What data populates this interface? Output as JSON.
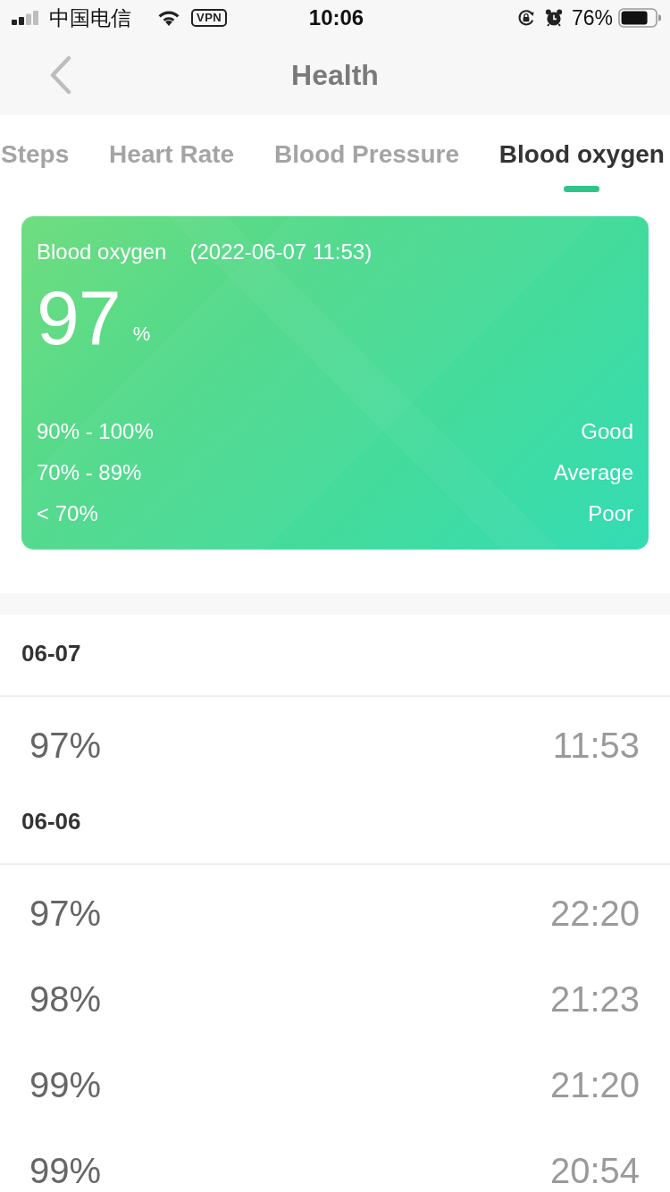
{
  "status_bar": {
    "carrier": "中国电信",
    "vpn": "VPN",
    "time": "10:06",
    "battery": "76%"
  },
  "nav": {
    "title": "Health"
  },
  "tabs": [
    {
      "label": "Steps",
      "selected": false
    },
    {
      "label": "Heart Rate",
      "selected": false
    },
    {
      "label": "Blood Pressure",
      "selected": false
    },
    {
      "label": "Blood oxygen",
      "selected": true
    }
  ],
  "card": {
    "title": "Blood oxygen",
    "timestamp": "(2022-06-07 11:53)",
    "value": "97",
    "unit": "%",
    "ranges": [
      {
        "range": "90% - 100%",
        "rating": "Good"
      },
      {
        "range": "70% - 89%",
        "rating": "Average"
      },
      {
        "range": "< 70%",
        "rating": "Poor"
      }
    ]
  },
  "history": [
    {
      "date": "06-07",
      "records": [
        {
          "value": "97%",
          "time": "11:53"
        }
      ]
    },
    {
      "date": "06-06",
      "records": [
        {
          "value": "97%",
          "time": "22:20"
        },
        {
          "value": "98%",
          "time": "21:23"
        },
        {
          "value": "99%",
          "time": "21:20"
        },
        {
          "value": "99%",
          "time": "20:54"
        }
      ]
    }
  ]
}
